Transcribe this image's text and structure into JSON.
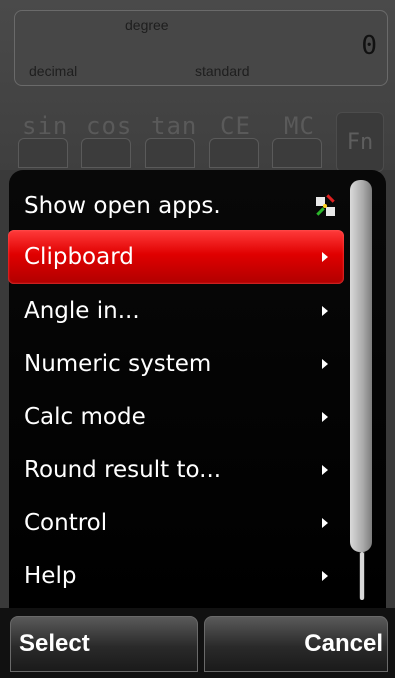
{
  "calculator": {
    "display": {
      "angle_mode": "degree",
      "numeric_system": "decimal",
      "calc_mode": "standard",
      "value": "0"
    },
    "keys": [
      "sin",
      "cos",
      "tan",
      "CE",
      "MC"
    ],
    "fn_label": "Fn"
  },
  "menu": {
    "items": [
      {
        "label": "Show open apps.",
        "icon": "open-apps-icon"
      },
      {
        "label": "Clipboard",
        "selected": true,
        "icon": "chevron-right-icon"
      },
      {
        "label": "Angle in...",
        "icon": "chevron-right-icon"
      },
      {
        "label": "Numeric system",
        "icon": "chevron-right-icon"
      },
      {
        "label": "Calc mode",
        "icon": "chevron-right-icon"
      },
      {
        "label": "Round result to...",
        "icon": "chevron-right-icon"
      },
      {
        "label": "Control",
        "icon": "chevron-right-icon"
      },
      {
        "label": "Help",
        "icon": "chevron-right-icon"
      }
    ],
    "selected_color": "#e00000"
  },
  "softkeys": {
    "left": "Select",
    "right": "Cancel"
  }
}
